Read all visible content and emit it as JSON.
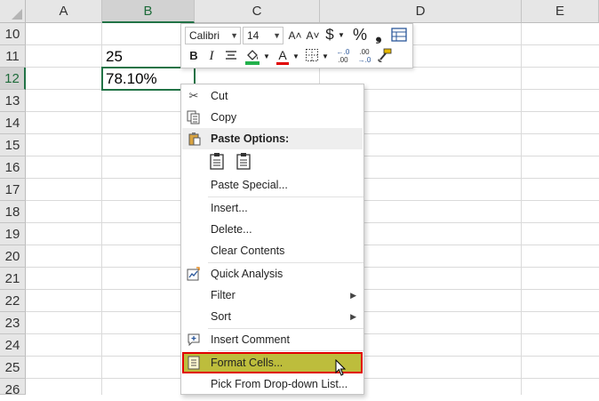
{
  "columns": [
    "A",
    "B",
    "C",
    "D",
    "E"
  ],
  "rows": [
    "10",
    "11",
    "12",
    "13",
    "14",
    "15",
    "16",
    "17",
    "18",
    "19",
    "20",
    "21",
    "22",
    "23",
    "24",
    "25",
    "26"
  ],
  "cells": {
    "B11": "25",
    "B12": "78.10%"
  },
  "mini_toolbar": {
    "font_name": "Calibri",
    "font_size": "14",
    "grow_font": "A˄",
    "shrink_font": "A˅",
    "currency": "$",
    "percent": "%",
    "comma": "❟",
    "bold": "B",
    "italic": "I",
    "font_color": "A",
    "dec_more": ".00→.0",
    "dec_less": ".00→.0"
  },
  "context_menu": {
    "cut": "Cut",
    "copy": "Copy",
    "paste_options": "Paste Options:",
    "paste_special": "Paste Special...",
    "insert": "Insert...",
    "delete": "Delete...",
    "clear_contents": "Clear Contents",
    "quick_analysis": "Quick Analysis",
    "filter": "Filter",
    "sort": "Sort",
    "insert_comment": "Insert Comment",
    "format_cells": "Format Cells...",
    "pick_from_list": "Pick From Drop-down List..."
  },
  "colors": {
    "excel_green": "#217346",
    "highlight": "#bdbd3c",
    "highlight_border": "#e00000"
  }
}
